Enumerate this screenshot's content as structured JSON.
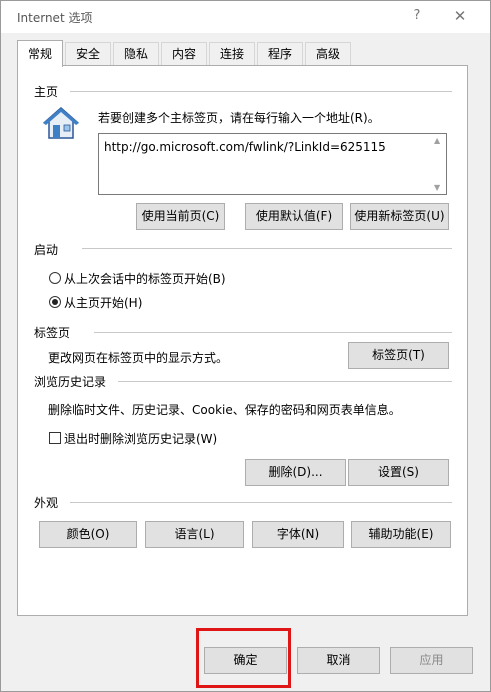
{
  "window": {
    "title": "Internet 选项",
    "help_icon": "?",
    "close_icon": "✕"
  },
  "tabs": [
    {
      "label": "常规"
    },
    {
      "label": "安全"
    },
    {
      "label": "隐私"
    },
    {
      "label": "内容"
    },
    {
      "label": "连接"
    },
    {
      "label": "程序"
    },
    {
      "label": "高级"
    }
  ],
  "home": {
    "title": "主页",
    "instruction": "若要创建多个主标签页，请在每行输入一个地址(R)。",
    "url": "http://go.microsoft.com/fwlink/?LinkId=625115",
    "btn_current": "使用当前页(C)",
    "btn_default": "使用默认值(F)",
    "btn_new": "使用新标签页(U)"
  },
  "startup": {
    "title": "启动",
    "option_last": "从上次会话中的标签页开始(B)",
    "option_home": "从主页开始(H)"
  },
  "tabs_section": {
    "title": "标签页",
    "desc": "更改网页在标签页中的显示方式。",
    "btn": "标签页(T)"
  },
  "history": {
    "title": "浏览历史记录",
    "desc": "删除临时文件、历史记录、Cookie、保存的密码和网页表单信息。",
    "checkbox": "退出时删除浏览历史记录(W)",
    "btn_delete": "删除(D)...",
    "btn_settings": "设置(S)"
  },
  "appearance": {
    "title": "外观",
    "btn_colors": "颜色(O)",
    "btn_lang": "语言(L)",
    "btn_fonts": "字体(N)",
    "btn_access": "辅助功能(E)"
  },
  "footer": {
    "ok": "确定",
    "cancel": "取消",
    "apply": "应用"
  },
  "colors": {
    "highlight": "#e01616",
    "accent_bg": "#e0161c"
  }
}
